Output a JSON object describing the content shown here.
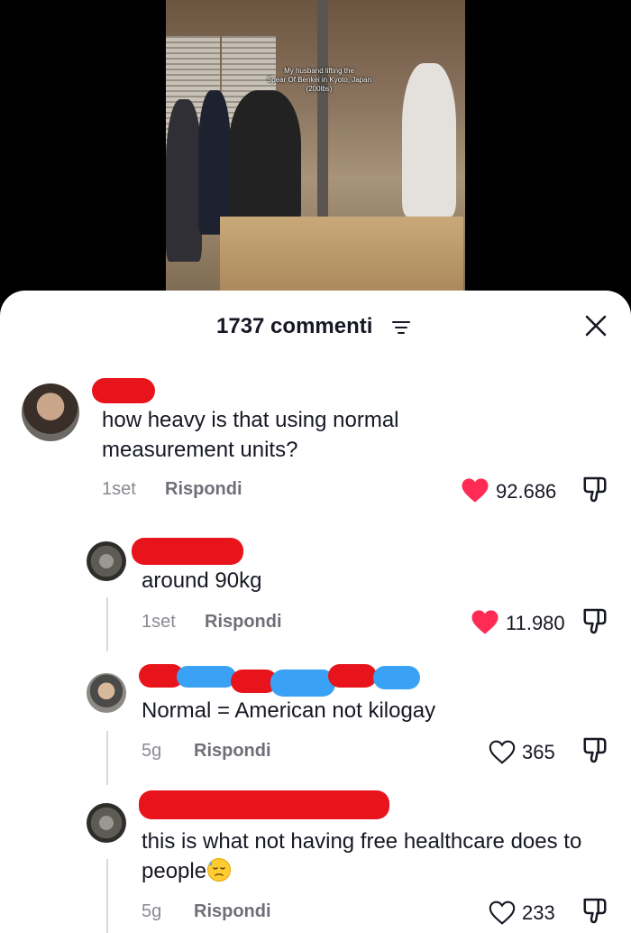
{
  "video": {
    "caption_lines": [
      "My husband lifting the",
      "Spear Of Benkei in Kyoto, Japan",
      "(200lbs)"
    ]
  },
  "sheet": {
    "comment_count": "1737 commenti",
    "filter_icon": "filter-lines-icon",
    "close_icon": "close-x-icon"
  },
  "comments": [
    {
      "text": "how heavy is that using normal measurement units?",
      "time": "1set",
      "reply_label": "Rispondi",
      "likes": "92.686",
      "liked": true
    },
    {
      "text": "around 90kg",
      "time": "1set",
      "reply_label": "Rispondi",
      "likes": "11.980",
      "liked": true
    },
    {
      "text": "Normal = American not kilogay",
      "time": "5g",
      "reply_label": "Rispondi",
      "likes": "365",
      "liked": false
    },
    {
      "text": "this is what not having free healthcare does to people",
      "emoji": "downcast-face-with-sweat",
      "time": "5g",
      "reply_label": "Rispondi",
      "likes": "233",
      "liked": false
    }
  ],
  "colors": {
    "like_red": "#fe2c55",
    "redaction_red": "#e8141c",
    "redaction_blue": "#3aa2f4",
    "meta_gray": "#8a8b91"
  }
}
